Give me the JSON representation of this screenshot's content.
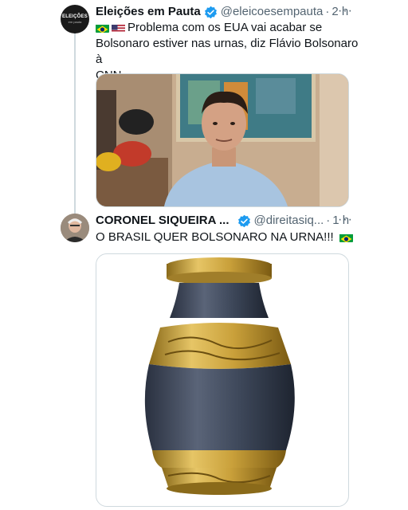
{
  "tweet1": {
    "avatar_text": "ELEIÇÕES",
    "avatar_subtext": "em pauta",
    "name": "Eleições em Pauta",
    "handle": "@eleicoesempauta",
    "separator": "·",
    "time": "2 h",
    "more": "···",
    "text_line1": "Problema com os EUA vai acabar se",
    "text_line2": "Bolsonaro estiver nas urnas, diz Flávio Bolsonaro à",
    "text_line3": "CNN."
  },
  "tweet2": {
    "name": "CORONEL SIQUEIRA ...",
    "handle": "@direitasiq...",
    "separator": "·",
    "time": "1 h",
    "more": "···",
    "text": "O BRASIL QUER BOLSONARO NA URNA!!!"
  },
  "colors": {
    "verified": "#1d9bf0",
    "secondary_text": "#536471",
    "border": "#cfd9de",
    "brazil_green": "#009c3b",
    "brazil_yellow": "#ffdf00",
    "brazil_blue": "#002776"
  },
  "icons": [
    "verified-badge-icon",
    "more-options-icon",
    "brazil-flag-icon",
    "usa-flag-icon"
  ]
}
